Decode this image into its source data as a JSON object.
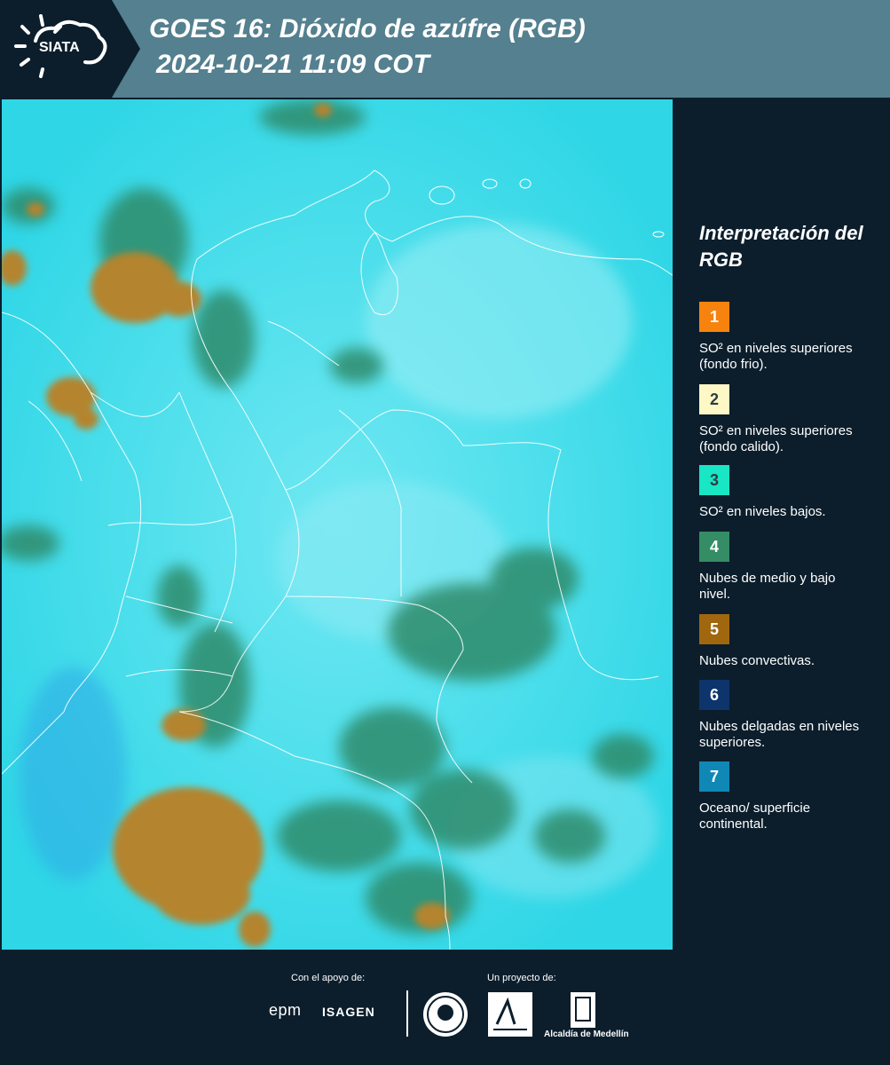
{
  "header": {
    "title_line1": "GOES 16: Dióxido de azúfre (RGB)",
    "title_line2": "2024-10-21 11:09 COT",
    "logo_text": "SIATA",
    "logo_icon": "sun-cloud-icon",
    "background_color": "#54808f"
  },
  "map": {
    "description_icon": "satellite-map-image",
    "base_color": "#34d8e6"
  },
  "legend": {
    "title": "Interpretación del RGB",
    "items": [
      {
        "number": "1",
        "color": "#f7830f",
        "text": "SO² en niveles superiores (fondo frio)."
      },
      {
        "number": "2",
        "color": "#fef8c6",
        "text": "SO² en niveles superiores (fondo calido)."
      },
      {
        "number": "3",
        "color": "#19e6c5",
        "text": "SO² en niveles bajos."
      },
      {
        "number": "4",
        "color": "#348d64",
        "text": "Nubes de medio y bajo nivel."
      },
      {
        "number": "5",
        "color": "#a0670f",
        "text": "Nubes convectivas."
      },
      {
        "number": "6",
        "color": "#0d346b",
        "text": "Nubes delgadas en niveles superiores."
      },
      {
        "number": "7",
        "color": "#1088b6",
        "text": "Oceano/ superficie continental."
      }
    ]
  },
  "footer": {
    "support_label": "Con el apoyo de:",
    "project_label": "Un proyecto de:",
    "sponsor1": "epm",
    "sponsor2": "ISAGEN",
    "partner_alcaldia": "Alcaldía de Medellín",
    "partner_area_icon": "area-metropolitana-logo",
    "partner_seal_icon": "medellin-seal-icon"
  },
  "colors": {
    "page_background": "#0c1e2c",
    "convective_cloud": "#b1822c",
    "green_cloud": "#2c8a6a",
    "border_lines": "#ffffff"
  }
}
